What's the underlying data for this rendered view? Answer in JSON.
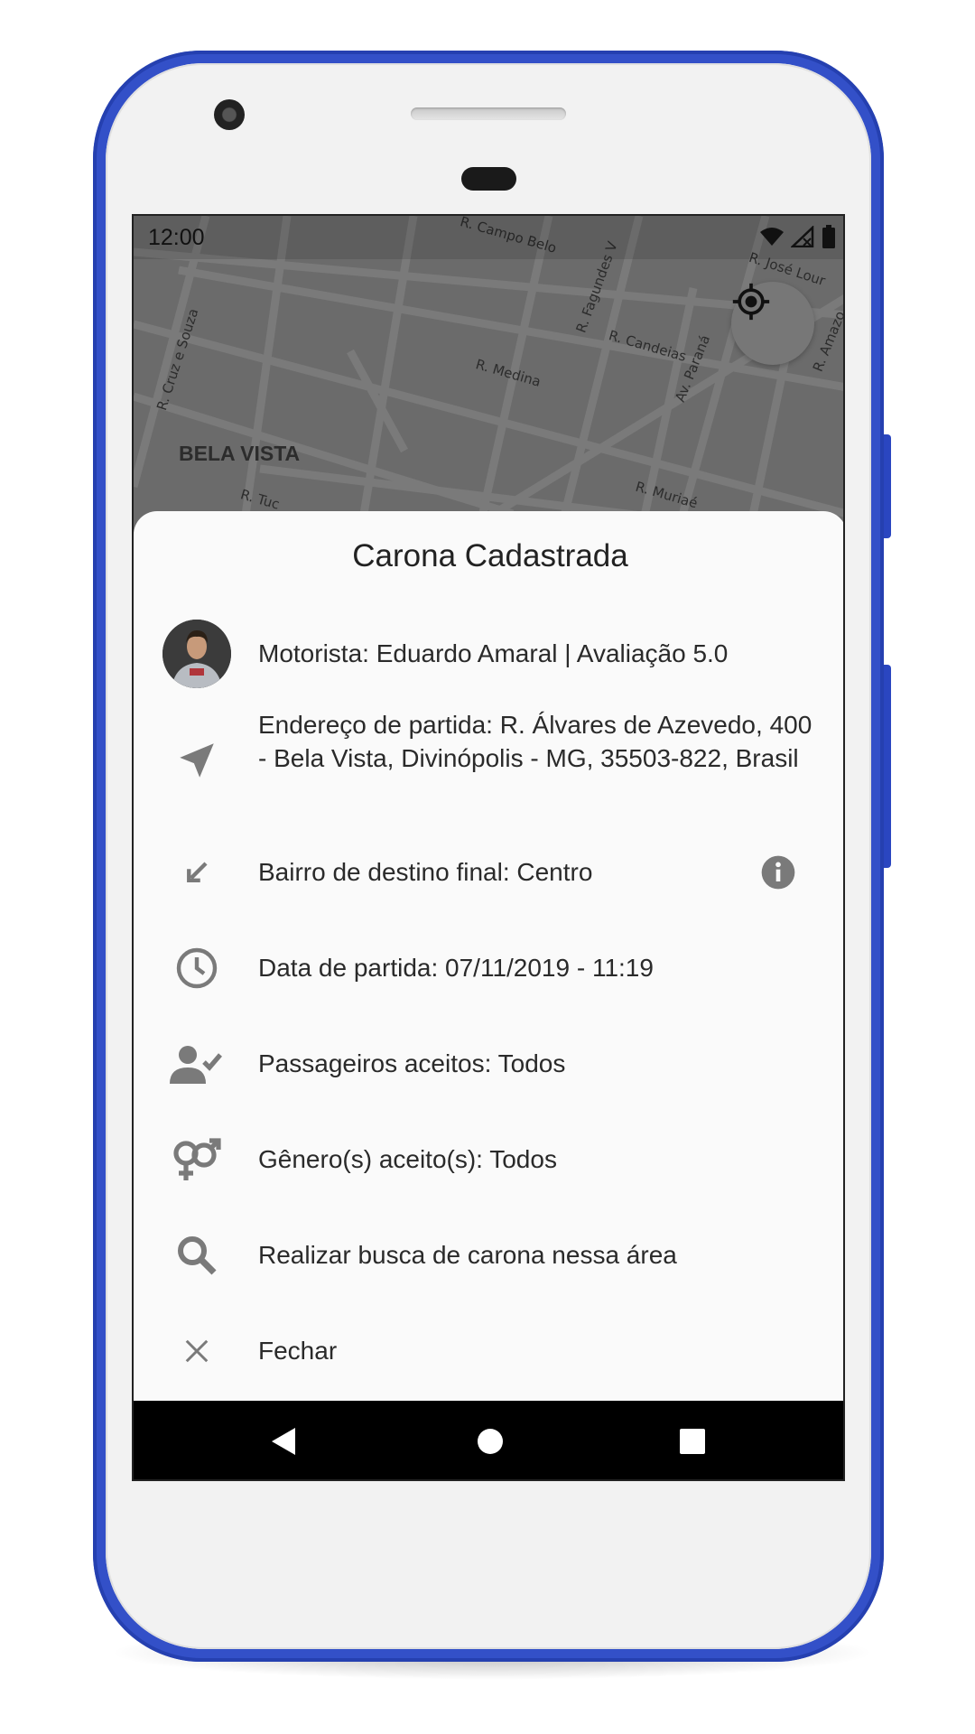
{
  "status_bar": {
    "time": "12:00"
  },
  "map": {
    "area_label": "BELA VISTA",
    "streets": [
      "R. Campo Belo",
      "R. Fagundes V",
      "R. José Lour",
      "R. Cruz e Souza",
      "R. Candeias",
      "R. Medina",
      "Av. Paraná",
      "R. Amazo",
      "R. Tuc",
      "R. Muriaé"
    ]
  },
  "sheet": {
    "title": "Carona Cadastrada",
    "driver": "Motorista: Eduardo Amaral | Avaliação 5.0",
    "start_address": "Endereço de partida: R. Álvares de Azevedo, 400 - Bela Vista, Divinópolis - MG, 35503-822, Brasil",
    "destination": "Bairro de destino final: Centro",
    "departure": "Data de partida: 07/11/2019 - 11:19",
    "passengers": "Passageiros aceitos: Todos",
    "genders": "Gênero(s) aceito(s): Todos",
    "search": "Realizar busca de carona nessa área",
    "close": "Fechar"
  },
  "colors": {
    "frame": "#3350c8",
    "icon_gray": "#7a7a7a",
    "sheet_bg": "#fafafa"
  }
}
